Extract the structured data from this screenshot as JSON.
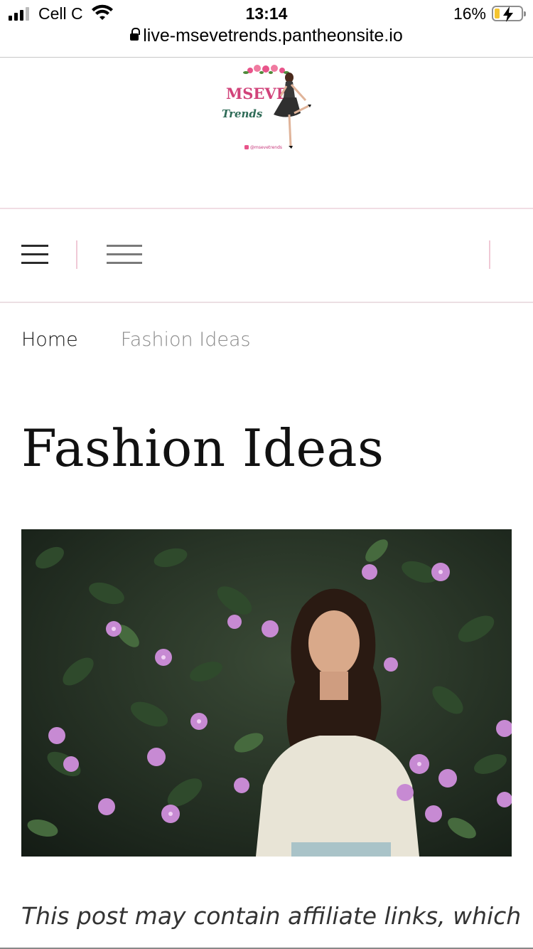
{
  "status_bar": {
    "carrier": "Cell C",
    "time": "13:14",
    "battery_percent": "16%",
    "battery_level": 0.16
  },
  "browser": {
    "url": "live-msevetrends.pantheonsite.io"
  },
  "site": {
    "logo": {
      "brand": "MSEVE",
      "sub": "Trends",
      "handle": "@msevetrends"
    }
  },
  "nav": {
    "menu_icon": "hamburger-icon",
    "secondary_icon": "menu-lines-icon"
  },
  "breadcrumb": {
    "home": "Home",
    "current": "Fashion Ideas"
  },
  "page": {
    "title": "Fashion Ideas",
    "disclaimer": "This post may contain affiliate links, which"
  },
  "colors": {
    "accent_pink": "#e8548a",
    "divider_pink": "#f1dde4",
    "text_dark": "#1a1a1a",
    "breadcrumb_muted": "#8a8a8a"
  }
}
